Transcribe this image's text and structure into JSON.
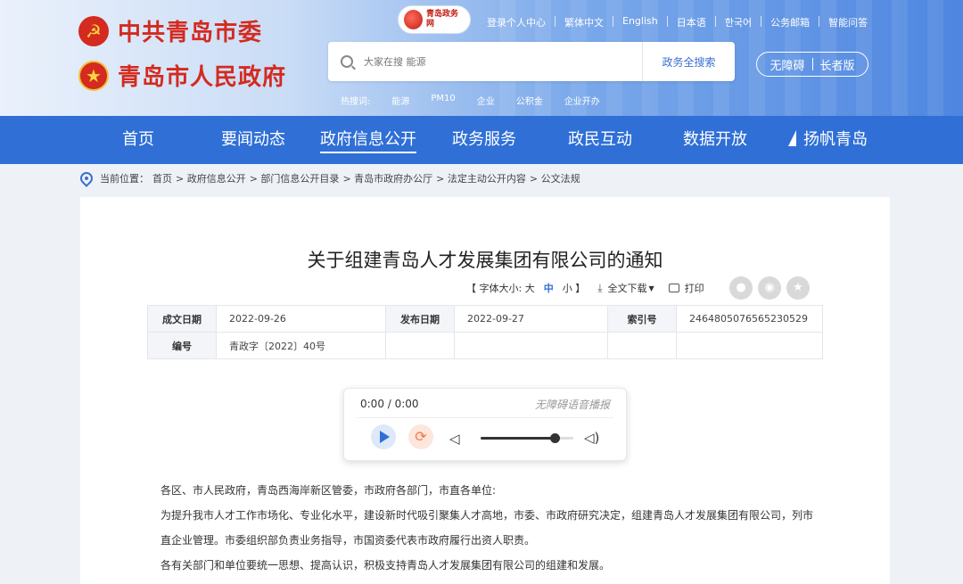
{
  "header": {
    "party_name": "中共青岛市委",
    "gov_name": "青岛市人民政府",
    "site_badge": "青岛政务网",
    "top_links": [
      "登录个人中心",
      "繁体中文",
      "English",
      "日本语",
      "한국어",
      "公务邮箱",
      "智能问答"
    ],
    "search": {
      "placeholder": "大家在搜 能源",
      "button": "政务全搜索"
    },
    "hot": {
      "label": "热搜词:",
      "words": [
        "能源",
        "PM10",
        "企业",
        "公积金",
        "企业开办"
      ]
    },
    "access": {
      "accessible": "无障碍",
      "elderly": "长者版"
    }
  },
  "nav": {
    "items": [
      "首页",
      "要闻动态",
      "政府信息公开",
      "政务服务",
      "政民互动",
      "数据开放",
      "扬帆青岛"
    ],
    "active_index": 2
  },
  "breadcrumb": {
    "label": "当前位置：",
    "items": [
      "首页",
      "> 政府信息公开",
      "> 部门信息公开目录",
      "> 青岛市政府办公厅",
      "> 法定主动公开内容",
      "> 公文法规"
    ]
  },
  "article": {
    "title": "关于组建青岛人才发展集团有限公司的通知",
    "font_size_label": "【 字体大小: 大",
    "font_mid": "中",
    "font_small": "小 】",
    "download": "全文下载",
    "print": "打印",
    "meta": {
      "date_label": "成文日期",
      "date_value": "2022-09-26",
      "publish_label": "发布日期",
      "publish_value": "2022-09-27",
      "index_label": "索引号",
      "index_value": "2464805076565230529",
      "number_label": "编号",
      "number_value": "青政字〔2022〕40号"
    },
    "player": {
      "time": "0:00 / 0:00",
      "label": "无障碍语音播报",
      "volume": 0.8
    },
    "paragraphs": [
      "各区、市人民政府，青岛西海岸新区管委，市政府各部门，市直各单位:",
      "为提升我市人才工作市场化、专业化水平，建设新时代吸引聚集人才高地，市委、市政府研究决定，组建青岛人才发展集团有限公司，列市直企业管理。市委组织部负责业务指导，市国资委代表市政府履行出资人职责。",
      "各有关部门和单位要统一思想、提高认识，积极支持青岛人才发展集团有限公司的组建和发展。"
    ]
  }
}
